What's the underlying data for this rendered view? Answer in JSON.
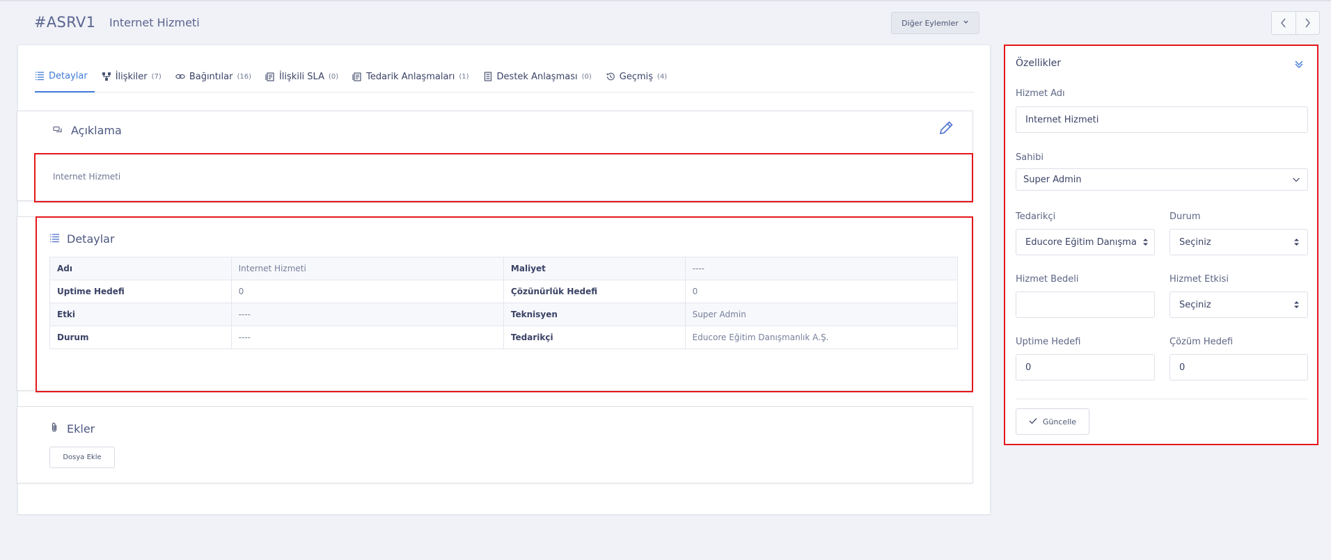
{
  "header": {
    "code": "#ASRV1",
    "title": "Internet Hizmeti",
    "other_actions_label": "Diğer Eylemler",
    "prev_icon": "chevron-left-icon",
    "next_icon": "chevron-right-icon"
  },
  "tabs": [
    {
      "label": "Detaylar",
      "count": "",
      "icon": "list-icon",
      "active": true
    },
    {
      "label": "İlişkiler",
      "count": "(7)",
      "icon": "hierarchy-icon",
      "active": false
    },
    {
      "label": "Bağıntılar",
      "count": "(16)",
      "icon": "link-icon",
      "active": false
    },
    {
      "label": "İlişkili SLA",
      "count": "(0)",
      "icon": "document-icon",
      "active": false
    },
    {
      "label": "Tedarik Anlaşmaları",
      "count": "(1)",
      "icon": "document-icon",
      "active": false
    },
    {
      "label": "Destek Anlaşması",
      "count": "(0)",
      "icon": "page-icon",
      "active": false
    },
    {
      "label": "Geçmiş",
      "count": "(4)",
      "icon": "history-icon",
      "active": false
    }
  ],
  "description": {
    "title": "Açıklama",
    "text": "Internet Hizmeti"
  },
  "details": {
    "title": "Detaylar",
    "rows": [
      {
        "k1": "Adı",
        "v1": "Internet Hizmeti",
        "k2": "Maliyet",
        "v2": "----"
      },
      {
        "k1": "Uptime Hedefi",
        "v1": "0",
        "k2": "Çözünürlük Hedefi",
        "v2": "0"
      },
      {
        "k1": "Etki",
        "v1": "----",
        "k2": "Teknisyen",
        "v2": "Super Admin"
      },
      {
        "k1": "Durum",
        "v1": "----",
        "k2": "Tedarikçi",
        "v2": "Educore Eğitim Danışmanlık A.Ş."
      }
    ]
  },
  "attachments": {
    "title": "Ekler",
    "add_file_label": "Dosya Ekle"
  },
  "properties": {
    "title": "Özellikler",
    "service_name_label": "Hizmet Adı",
    "service_name_value": "Internet Hizmeti",
    "owner_label": "Sahibi",
    "owner_value": "Super  Admin",
    "supplier_label": "Tedarikçi",
    "supplier_value": "Educore Eğitim Danışmanlık A.Ş.",
    "status_label": "Durum",
    "status_value": "Seçiniz",
    "service_fee_label": "Hizmet Bedeli",
    "service_fee_value": "",
    "service_impact_label": "Hizmet Etkisi",
    "service_impact_value": "Seçiniz",
    "uptime_label": "Uptime Hedefi",
    "uptime_value": "0",
    "solution_label": "Çözüm Hedefi",
    "solution_value": "0",
    "update_label": "Güncelle"
  },
  "colors": {
    "accent": "#3f7ad6",
    "highlight": "#e5161b"
  }
}
